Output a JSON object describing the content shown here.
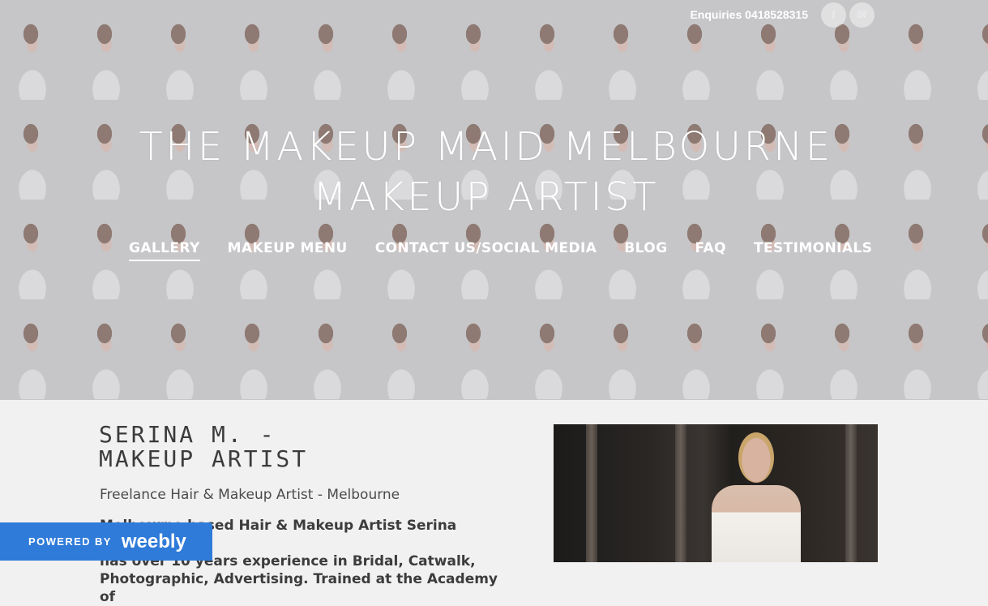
{
  "header": {
    "enquiries": "Enquiries 0418528315",
    "social": [
      {
        "icon": "facebook-icon",
        "glyph": "f"
      },
      {
        "icon": "email-icon",
        "glyph": "✉"
      }
    ],
    "title_line1": "THE MAKEUP MAID MELBOURNE",
    "title_line2": "MAKEUP ARTIST"
  },
  "nav": {
    "items": [
      {
        "label": "GALLERY",
        "active": true
      },
      {
        "label": "MAKEUP MENU"
      },
      {
        "label": "CONTACT US/SOCIAL MEDIA"
      },
      {
        "label": "BLOG"
      },
      {
        "label": "FAQ"
      },
      {
        "label": "TESTIMONIALS"
      }
    ]
  },
  "main": {
    "heading_line1": "SERINA M. -",
    "heading_line2": "MAKEUP ARTIST",
    "subtitle": "Freelance Hair & Makeup Artist - Melbourne",
    "body_line1": "Melbourne based Hair & Makeup Artist Serina Martic",
    "body_line2": "has over 10 years experience in Bridal, Catwalk,",
    "body_line3": "Photographic, Advertising. Trained at the Academy of"
  },
  "footer_badge": {
    "powered_by": "POWERED BY",
    "brand": "weebly"
  }
}
